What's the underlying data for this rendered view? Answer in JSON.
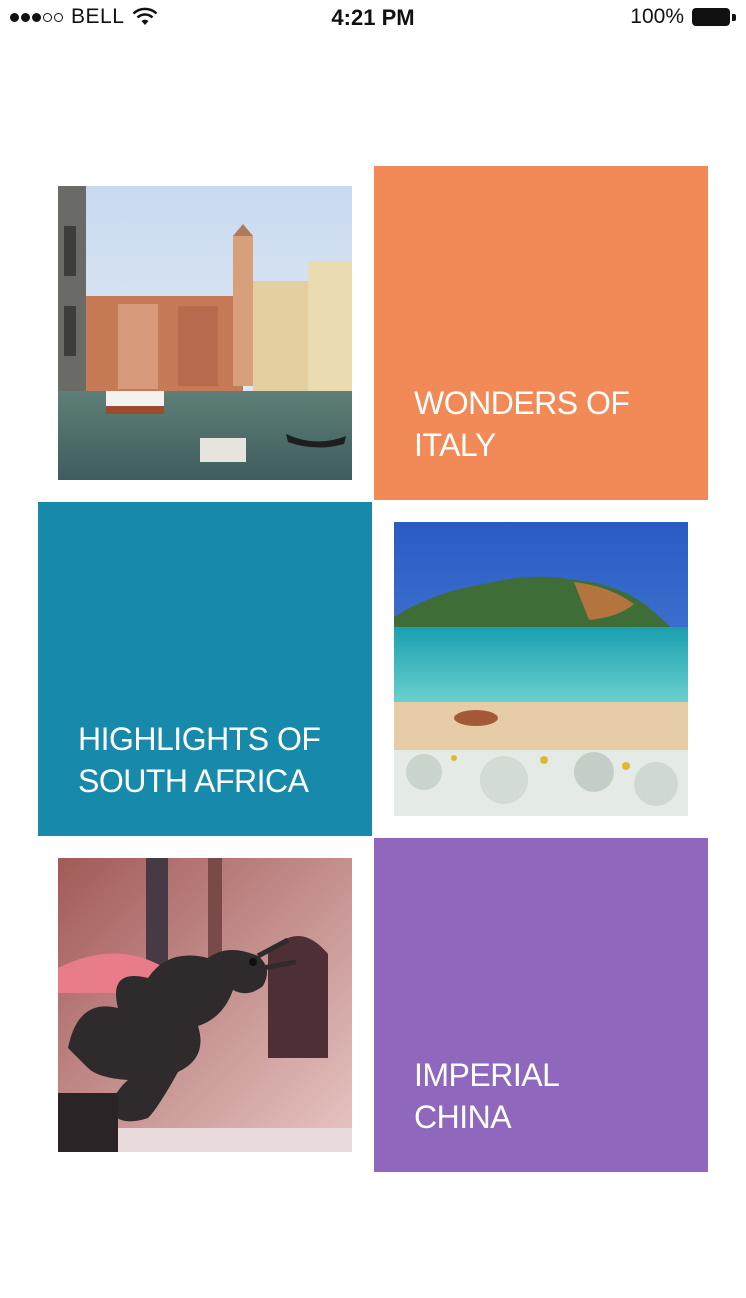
{
  "status_bar": {
    "carrier": "BELL",
    "time": "4:21 PM",
    "battery": "100%",
    "signal_icon": "signal-dots-icon",
    "wifi_icon": "wifi-icon",
    "battery_icon": "battery-icon"
  },
  "tiles": [
    {
      "title": "WONDERS OF ITALY",
      "color": "#F28A57",
      "image": "venice-canal-photo"
    },
    {
      "title": "HIGHLIGHTS OF SOUTH AFRICA",
      "color": "#1789AB",
      "image": "south-africa-beach-photo"
    },
    {
      "title": "IMPERIAL CHINA",
      "color": "#8F67BC",
      "image": "chinese-dragon-statue-photo"
    }
  ]
}
